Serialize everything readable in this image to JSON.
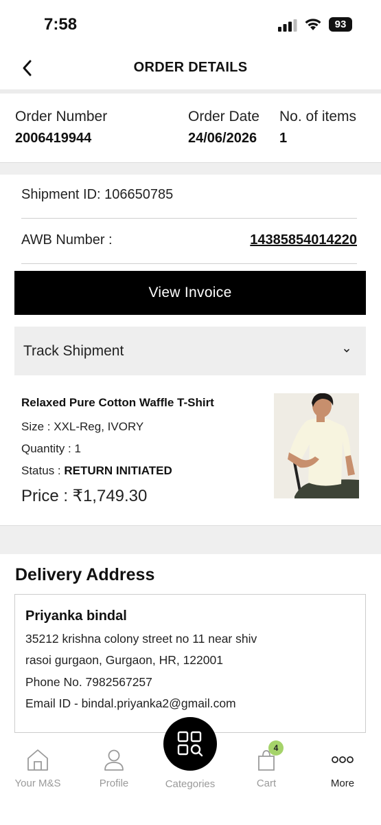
{
  "status_bar": {
    "time": "7:58",
    "battery": "93"
  },
  "header": {
    "title": "ORDER DETAILS"
  },
  "order": {
    "number_label": "Order Number",
    "number": "2006419944",
    "date_label": "Order Date",
    "date": "24/06/2026",
    "items_label": "No. of items",
    "items": "1"
  },
  "shipment": {
    "id_text": "Shipment ID: 106650785",
    "awb_label": "AWB Number :",
    "awb_number": "14385854014220",
    "invoice_button": "View Invoice",
    "track_label": "Track Shipment"
  },
  "product": {
    "name": "Relaxed Pure Cotton Waffle T-Shirt",
    "size_text": "Size : XXL-Reg, IVORY",
    "quantity_text": "Quantity : 1",
    "status_label": "Status : ",
    "status_value": "RETURN INITIATED",
    "price_text": "Price : ₹1,749.30"
  },
  "delivery": {
    "title": "Delivery Address",
    "name": "Priyanka bindal",
    "address_line1": "35212 krishna colony street no 11 near shiv",
    "address_line2": "rasoi gurgaon, Gurgaon, HR, 122001",
    "phone_text": "Phone No. 7982567257",
    "email_text": "Email ID - bindal.priyanka2@gmail.com"
  },
  "nav": {
    "home": "Your M&S",
    "profile": "Profile",
    "categories": "Categories",
    "cart": "Cart",
    "cart_count": "4",
    "more": "More"
  },
  "colors": {
    "primary": "#000000",
    "badge": "#a5d36a",
    "divider": "#efefef"
  }
}
